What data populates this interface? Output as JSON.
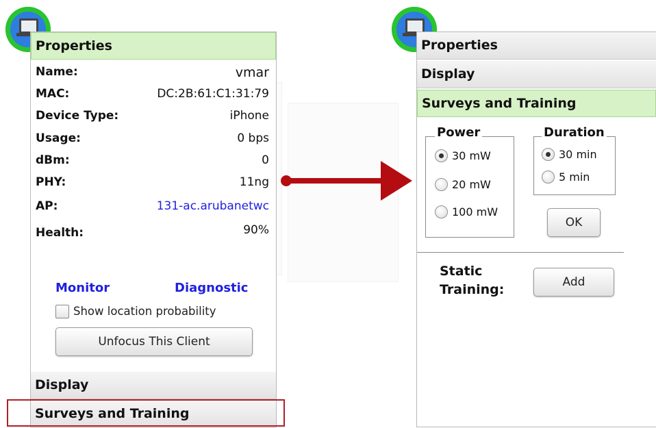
{
  "left_panel": {
    "properties_header": "Properties",
    "rows": [
      {
        "key": "Name:",
        "value": "vmar"
      },
      {
        "key": "MAC:",
        "value": "DC:2B:61:C1:31:79"
      },
      {
        "key": "Device Type:",
        "value": "iPhone"
      },
      {
        "key": "Usage:",
        "value": "0 bps"
      },
      {
        "key": "dBm:",
        "value": "0"
      },
      {
        "key": "PHY:",
        "value": "11ng"
      },
      {
        "key": "AP:",
        "value": "131-ac.arubanetwc"
      },
      {
        "key": "Health:",
        "value": "90%"
      }
    ],
    "monitor_link": "Monitor",
    "diagnostic_link": "Diagnostic",
    "show_location_label": "Show location probability",
    "unfocus_button": "Unfocus This Client",
    "display_header": "Display",
    "surveys_header": "Surveys and Training"
  },
  "right_panel": {
    "properties_header": "Properties",
    "display_header": "Display",
    "surveys_header": "Surveys and Training",
    "power": {
      "legend": "Power",
      "options": [
        "30 mW",
        "20 mW",
        "100 mW"
      ],
      "selected": "30 mW"
    },
    "duration": {
      "legend": "Duration",
      "options": [
        "30 min",
        "5 min"
      ],
      "selected": "30 min"
    },
    "ok_button": "OK",
    "static_training_label_line1": "Static",
    "static_training_label_line2": "Training:",
    "add_button": "Add"
  },
  "colors": {
    "active_header": "#d7f2c6",
    "link": "#1f1fe0",
    "arrow": "#b30d12",
    "highlight": "#b01f24"
  }
}
